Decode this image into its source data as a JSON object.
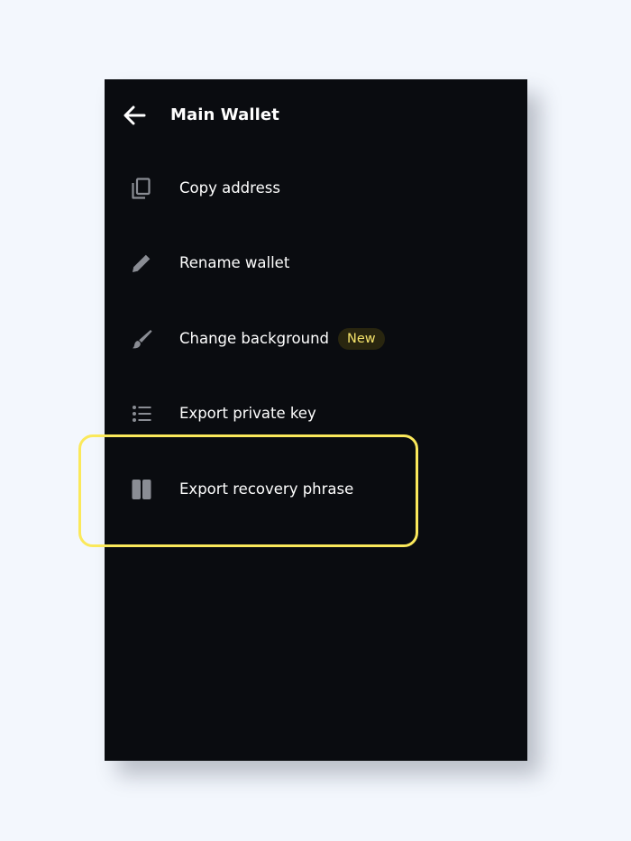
{
  "header": {
    "title": "Main Wallet",
    "back_icon": "arrow-left-icon"
  },
  "menu": {
    "items": [
      {
        "label": "Copy address",
        "icon": "copy-icon"
      },
      {
        "label": "Rename wallet",
        "icon": "pencil-icon"
      },
      {
        "label": "Change background",
        "icon": "brush-icon",
        "badge": "New"
      },
      {
        "label": "Export private key",
        "icon": "list-icon"
      },
      {
        "label": "Export recovery phrase",
        "icon": "book-icon"
      }
    ]
  },
  "colors": {
    "page_background": "#f3f7fd",
    "panel_background": "#0a0c10",
    "text": "#ffffff",
    "icon": "#8a8d94",
    "badge_text": "#f4e26a",
    "badge_background": "#29260f",
    "highlight": "#fbe95b"
  }
}
